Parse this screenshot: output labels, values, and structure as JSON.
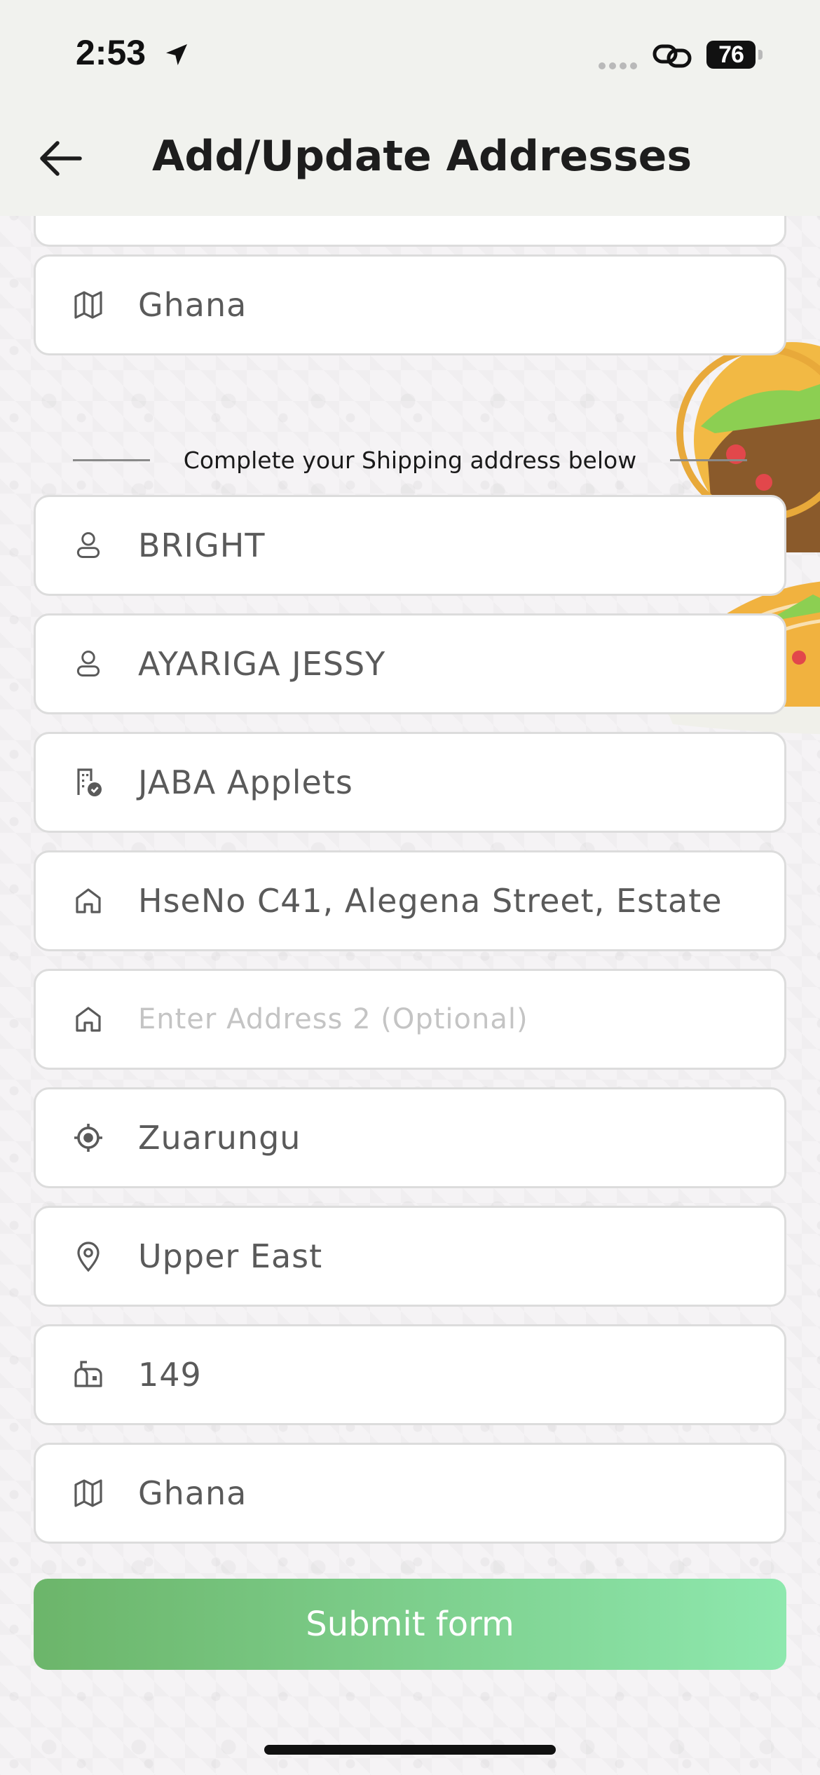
{
  "status_bar": {
    "time": "2:53",
    "battery": "76"
  },
  "header": {
    "title": "Add/Update Addresses"
  },
  "billing": {
    "country": "Ghana"
  },
  "shipping": {
    "heading": "Complete your Shipping address below",
    "first_name": "BRIGHT",
    "last_name": "AYARIGA JESSY",
    "company": "JABA Applets",
    "address1": "HseNo C41, Alegena Street, Estate",
    "address2_placeholder": "Enter Address 2 (Optional)",
    "city": "Zuarungu",
    "region": "Upper East",
    "postcode": "149",
    "country": "Ghana"
  },
  "actions": {
    "submit_label": "Submit form"
  },
  "colors": {
    "accent_start": "#6cb56a",
    "accent_end": "#8ee8ae"
  }
}
